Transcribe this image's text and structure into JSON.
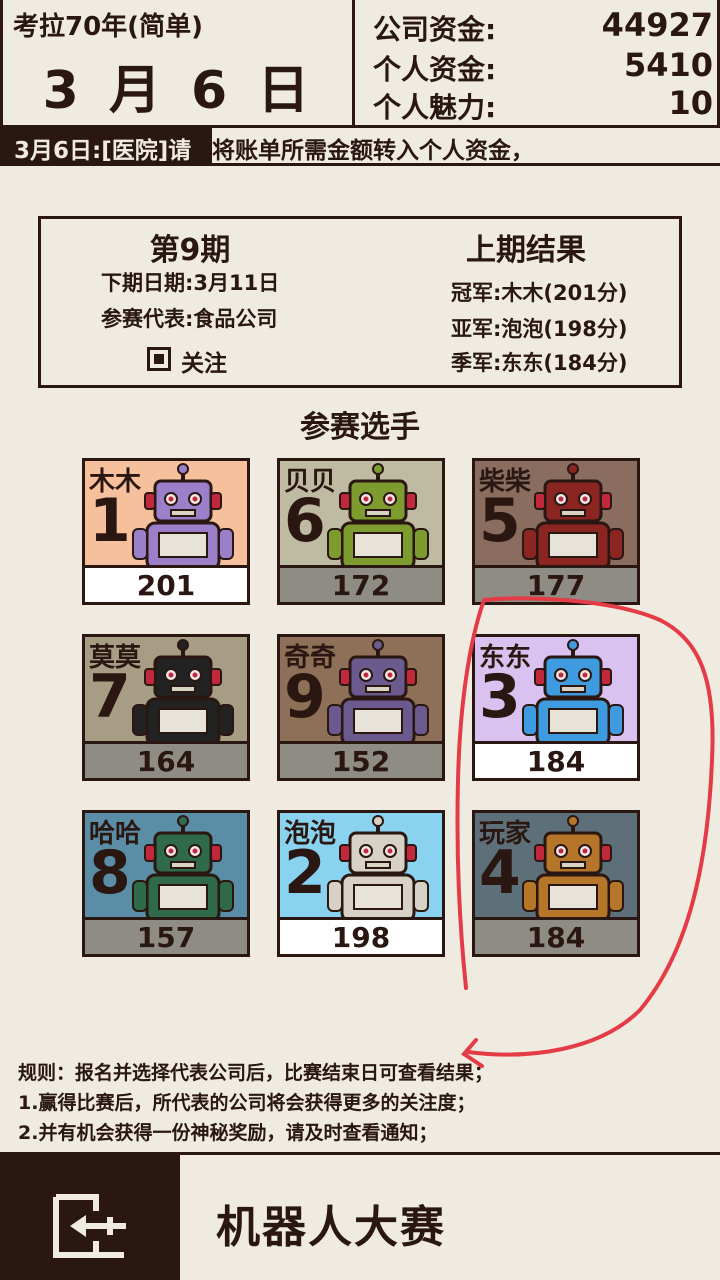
{
  "header": {
    "game_title": "考拉70年(简单)",
    "date": "3 月 6 日",
    "stats": [
      {
        "label": "公司资金:",
        "value": "44927"
      },
      {
        "label": "个人资金:",
        "value": "5410"
      },
      {
        "label": "个人魅力:",
        "value": "10"
      }
    ]
  },
  "ticker": {
    "date": "3月6日:[医院]请",
    "text": "将账单所需金额转入个人资金，"
  },
  "info": {
    "period": "第9期",
    "next_date": "下期日期:3月11日",
    "representative": "参赛代表:食品公司",
    "follow_label": "关注",
    "follow_checked": true,
    "last_result_title": "上期结果",
    "results": [
      "冠军:木木(201分)",
      "亚军:泡泡(198分)",
      "季军:东东(184分)"
    ]
  },
  "contestants_title": "参赛选手",
  "contestants": [
    {
      "name": "木木",
      "number": "1",
      "score": "201",
      "bg": "#f6c09d",
      "robot": "#9b7fc9"
    },
    {
      "name": "贝贝",
      "number": "6",
      "score": "172",
      "bg": "#bfbba2",
      "robot": "#7e9b2f"
    },
    {
      "name": "柴柴",
      "number": "5",
      "score": "177",
      "bg": "#8b6d5f",
      "robot": "#8a2522"
    },
    {
      "name": "莫莫",
      "number": "7",
      "score": "164",
      "bg": "#a79d84",
      "robot": "#222222"
    },
    {
      "name": "奇奇",
      "number": "9",
      "score": "152",
      "bg": "#8e6f58",
      "robot": "#6b5a8e"
    },
    {
      "name": "东东",
      "number": "3",
      "score": "184",
      "bg": "#d9c2f0",
      "robot": "#3f9be0"
    },
    {
      "name": "哈哈",
      "number": "8",
      "score": "157",
      "bg": "#5a8ea6",
      "robot": "#2f6a4b"
    },
    {
      "name": "泡泡",
      "number": "2",
      "score": "198",
      "bg": "#8ad3f0",
      "robot": "#d8d2c6"
    },
    {
      "name": "玩家",
      "number": "4",
      "score": "184",
      "bg": "#5d6f78",
      "robot": "#b5762a"
    }
  ],
  "rules": [
    "规则：报名并选择代表公司后，比赛结束日可查看结果；",
    "1.赢得比赛后，所代表的公司将会获得更多的关注度；",
    "2.并有机会获得一份神秘奖励，请及时查看通知；"
  ],
  "footer": {
    "title": "机器人大赛",
    "exit_icon": "exit-door-icon"
  }
}
